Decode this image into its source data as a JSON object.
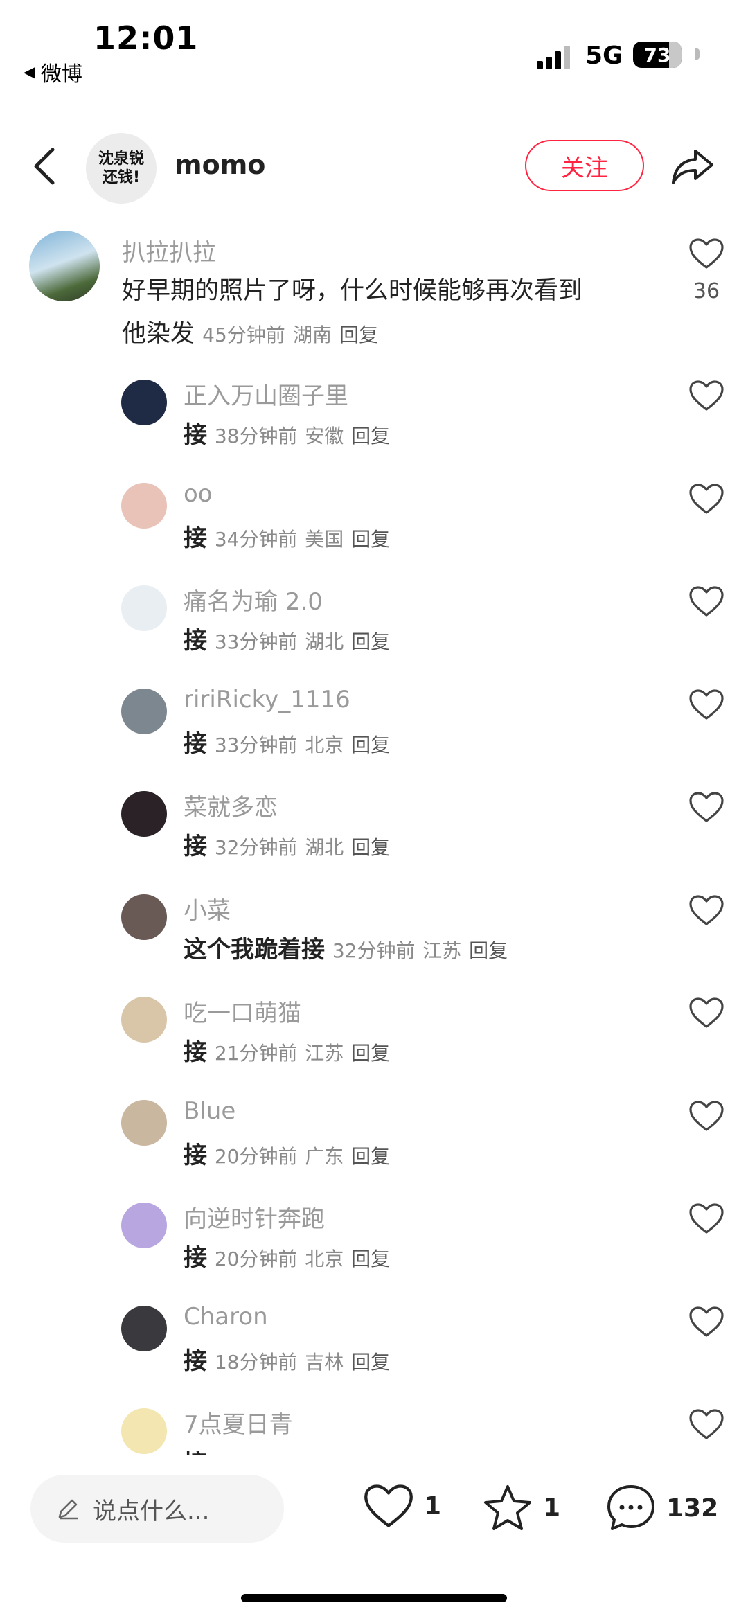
{
  "status_bar": {
    "time": "12:01",
    "back_app": "微博",
    "network": "5G",
    "battery": "73"
  },
  "header": {
    "avatar_text_line1": "沈泉锐",
    "avatar_text_line2": "还钱!",
    "name": "momo",
    "follow_label": "关注"
  },
  "main_comment": {
    "author": "扒拉扒拉",
    "text_line1": "好早期的照片了呀，什么时候能够再次看到",
    "text_line2": "他染发",
    "time": "45分钟前",
    "location": "湖南",
    "reply_label": "回复",
    "likes": "36"
  },
  "replies": [
    {
      "author": "正入万山圈子里",
      "text": "接",
      "time": "38分钟前",
      "location": "安徽",
      "reply_label": "回复",
      "avatar_color": "#1f2a44"
    },
    {
      "author": "oo",
      "text": "接",
      "time": "34分钟前",
      "location": "美国",
      "reply_label": "回复",
      "avatar_color": "#e9c3b8"
    },
    {
      "author": "痛名为瑜 2.0",
      "text": "接",
      "time": "33分钟前",
      "location": "湖北",
      "reply_label": "回复",
      "avatar_color": "#e8eef2"
    },
    {
      "author": "ririRicky_1116",
      "text": "接",
      "time": "33分钟前",
      "location": "北京",
      "reply_label": "回复",
      "avatar_color": "#7d8790"
    },
    {
      "author": "菜就多恋",
      "text": "接",
      "time": "32分钟前",
      "location": "湖北",
      "reply_label": "回复",
      "avatar_color": "#2a2226"
    },
    {
      "author": "小菜",
      "text": "这个我跪着接",
      "time": "32分钟前",
      "location": "江苏",
      "reply_label": "回复",
      "avatar_color": "#6a5a55"
    },
    {
      "author": "吃一口萌猫",
      "text": "接",
      "time": "21分钟前",
      "location": "江苏",
      "reply_label": "回复",
      "avatar_color": "#d9c6a8"
    },
    {
      "author": "Blue",
      "text": "接",
      "time": "20分钟前",
      "location": "广东",
      "reply_label": "回复",
      "avatar_color": "#c9b7a0"
    },
    {
      "author": "向逆时针奔跑",
      "text": "接",
      "time": "20分钟前",
      "location": "北京",
      "reply_label": "回复",
      "avatar_color": "#b8a6e0"
    },
    {
      "author": "Charon",
      "text": "接",
      "time": "18分钟前",
      "location": "吉林",
      "reply_label": "回复",
      "avatar_color": "#3a3a3e"
    },
    {
      "author": "7点夏日青",
      "text": "接",
      "time": "",
      "location": "",
      "reply_label": "",
      "avatar_color": "#f3e6b0"
    }
  ],
  "bottom_bar": {
    "input_placeholder": "说点什么...",
    "like_count": "1",
    "star_count": "1",
    "comment_count": "132"
  },
  "colors": {
    "accent": "#ff2442",
    "meta_gray": "#8a8a8a",
    "author_gray": "#9a9a9a"
  },
  "icons": [
    "back-arrow-icon",
    "share-icon",
    "heart-icon",
    "pencil-icon",
    "star-icon",
    "comment-bubble-icon"
  ]
}
